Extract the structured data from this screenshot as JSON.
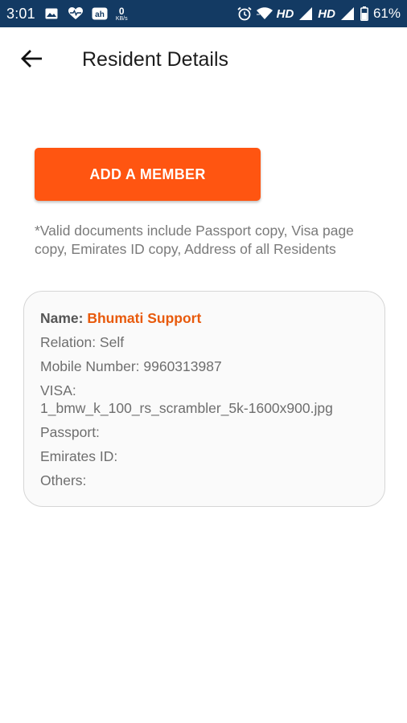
{
  "status_bar": {
    "time": "3:01",
    "net_speed_value": "0",
    "net_speed_unit": "KB/s",
    "network_label_1": "HD",
    "network_label_2": "HD",
    "battery_percent": "61%",
    "bg_color": "#133a63"
  },
  "header": {
    "title": "Resident Details"
  },
  "add_member": {
    "label": "ADD A MEMBER",
    "color": "#ff5511"
  },
  "note": "*Valid documents include Passport copy, Visa page copy, Emirates ID copy, Address of all Residents",
  "resident": {
    "name_label": "Name: ",
    "name_value": "Bhumati Support",
    "relation": "Relation: Self",
    "mobile": "Mobile Number: 9960313987",
    "visa_label": "VISA:",
    "visa_file": "1_bmw_k_100_rs_scrambler_5k-1600x900.jpg",
    "passport": "Passport:",
    "emirates_id": "Emirates ID:",
    "others": "Others:",
    "accent_color": "#e85a0c"
  }
}
